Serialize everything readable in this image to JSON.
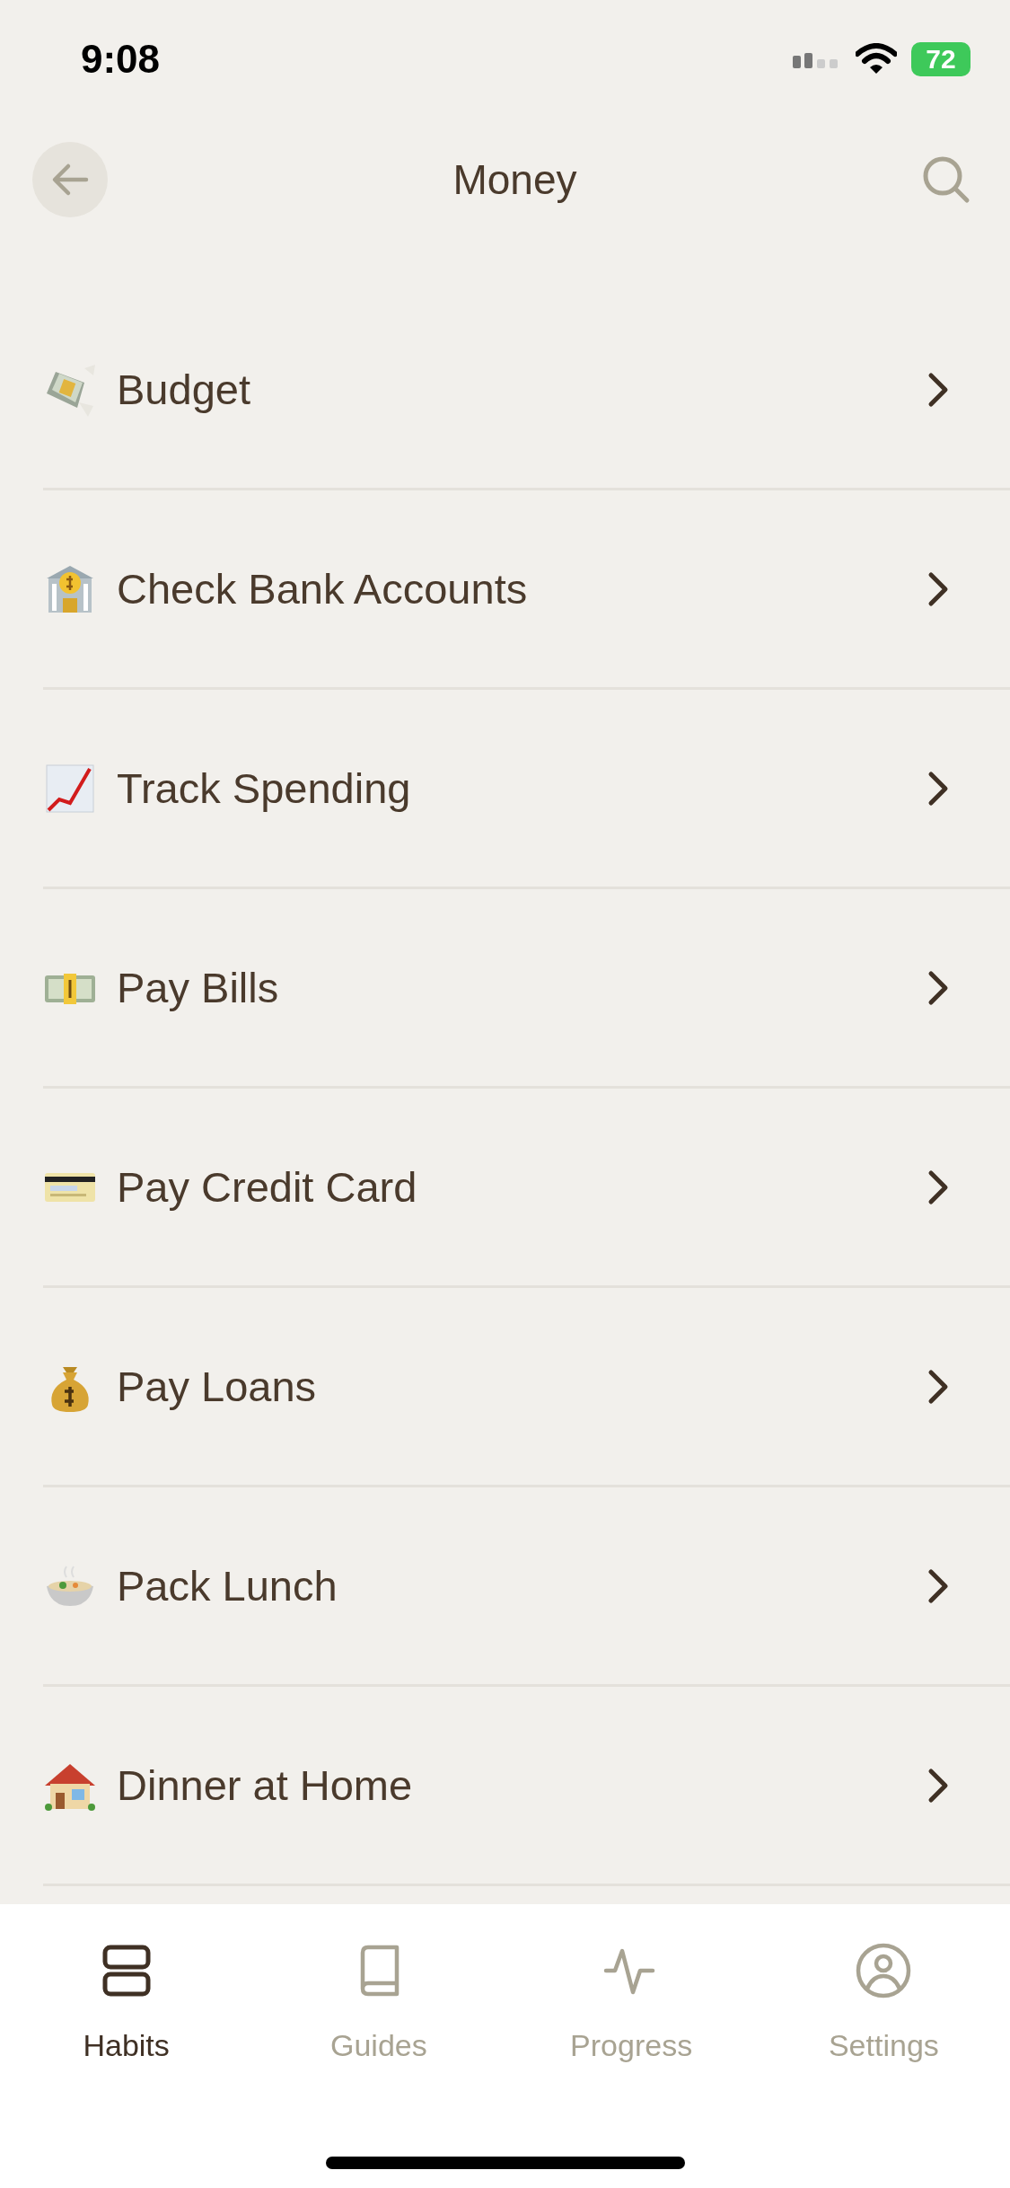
{
  "status_bar": {
    "time": "9:08",
    "battery": "72"
  },
  "header": {
    "title": "Money"
  },
  "items": [
    {
      "label": "Budget",
      "kind": "flying-money"
    },
    {
      "label": "Check Bank Accounts",
      "kind": "bank"
    },
    {
      "label": "Track Spending",
      "kind": "chart"
    },
    {
      "label": "Pay Bills",
      "kind": "banknote"
    },
    {
      "label": "Pay Credit Card",
      "kind": "card"
    },
    {
      "label": "Pay Loans",
      "kind": "moneybag"
    },
    {
      "label": "Pack Lunch",
      "kind": "bowl"
    },
    {
      "label": "Dinner at Home",
      "kind": "house"
    }
  ],
  "tabs": [
    {
      "label": "Habits",
      "kind": "stack",
      "selected": true
    },
    {
      "label": "Guides",
      "kind": "book",
      "selected": false
    },
    {
      "label": "Progress",
      "kind": "pulse",
      "selected": false
    },
    {
      "label": "Settings",
      "kind": "person",
      "selected": false
    }
  ]
}
